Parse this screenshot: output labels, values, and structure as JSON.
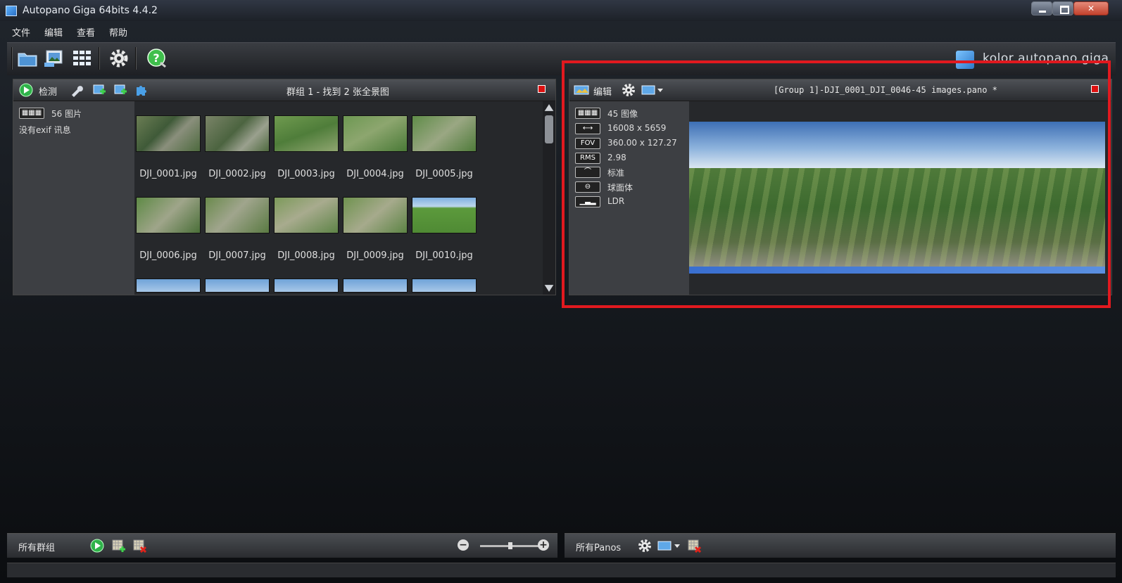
{
  "window": {
    "title": "Autopano Giga 64bits 4.4.2"
  },
  "menu": {
    "items": [
      "文件",
      "编辑",
      "查看",
      "帮助"
    ]
  },
  "toolbar": {
    "icons": [
      "open-folder-icon",
      "import-images-icon",
      "grid-view-icon",
      "settings-gear-icon",
      "help-icon"
    ],
    "logo_text": "kolor autopano giga"
  },
  "left_panel": {
    "detect_label": "检测",
    "header_title": "群组 1 - 找到 2 张全景图",
    "image_count": "56 图片",
    "exif_note": "没有exif 讯息",
    "thumbnails": [
      {
        "name": "DJI_0001.jpg"
      },
      {
        "name": "DJI_0002.jpg"
      },
      {
        "name": "DJI_0003.jpg"
      },
      {
        "name": "DJI_0004.jpg"
      },
      {
        "name": "DJI_0005.jpg"
      },
      {
        "name": "DJI_0006.jpg"
      },
      {
        "name": "DJI_0007.jpg"
      },
      {
        "name": "DJI_0008.jpg"
      },
      {
        "name": "DJI_0009.jpg"
      },
      {
        "name": "DJI_0010.jpg"
      }
    ]
  },
  "right_panel": {
    "edit_label": "编辑",
    "header_title": "[Group 1]-DJI_0001_DJI_0046-45 images.pano *",
    "info": {
      "images": "45 图像",
      "size": "16008 x 5659",
      "fov_badge": "FOV",
      "fov": "360.00 x 127.27",
      "rms_badge": "RMS",
      "rms": "2.98",
      "projection": "标准",
      "type": "球面体",
      "range": "LDR"
    }
  },
  "bottom": {
    "left_label": "所有群组",
    "right_label": "所有Panos"
  },
  "colors": {
    "highlight": "#e1191f",
    "panel_bg": "#2b2d30",
    "accent_blue": "#3a7fd6",
    "play_green": "#2fb34a"
  }
}
